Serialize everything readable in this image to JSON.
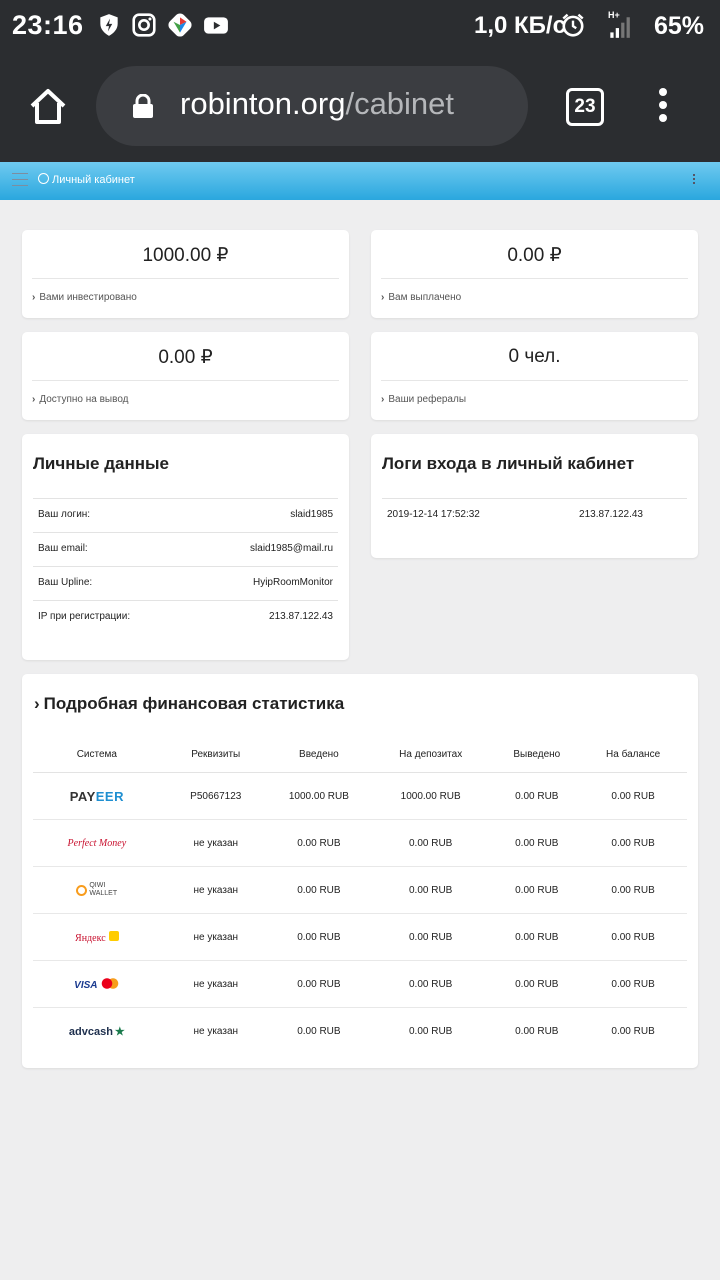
{
  "status_bar": {
    "time": "23:16",
    "net_speed": "1,0 КБ/с",
    "network": "H+",
    "battery": "65%",
    "left_icons": [
      "shield-bolt-icon",
      "instagram-icon",
      "cube-app-icon",
      "youtube-icon"
    ],
    "right_icons": [
      "alarm-icon",
      "signal-icon"
    ]
  },
  "browser": {
    "url_host": "robinton.org",
    "url_path": "/cabinet",
    "tab_count": "23"
  },
  "site_header": {
    "title": "Личный кабинет"
  },
  "stats": [
    {
      "value": "1000.00 ₽",
      "label": "Вами инвестировано"
    },
    {
      "value": "0.00 ₽",
      "label": "Вам выплачено"
    },
    {
      "value": "0.00 ₽",
      "label": "Доступно на вывод"
    },
    {
      "value": "0 чел.",
      "label": "Ваши рефералы"
    }
  ],
  "personal": {
    "title": "Личные данные",
    "rows": [
      {
        "label": "Ваш логин:",
        "value": "slaid1985"
      },
      {
        "label": "Ваш email:",
        "value": "slaid1985@mail.ru"
      },
      {
        "label": "Ваш Upline:",
        "value": "HyipRoomMonitor"
      },
      {
        "label": "IP при регистрации:",
        "value": "213.87.122.43"
      }
    ]
  },
  "logins": {
    "title": "Логи входа в личный кабинет",
    "rows": [
      {
        "date": "2019-12-14 17:52:32",
        "ip": "213.87.122.43"
      }
    ]
  },
  "finance": {
    "title": "Подробная финансовая статистика",
    "columns": [
      "Система",
      "Реквизиты",
      "Введено",
      "На депозитах",
      "Выведено",
      "На балансе"
    ],
    "rows": [
      {
        "system": "PAYEER",
        "details": "P50667123",
        "deposited": "1000.00 RUB",
        "on_deposits": "1000.00 RUB",
        "withdrawn": "0.00 RUB",
        "balance": "0.00 RUB"
      },
      {
        "system": "Perfect Money",
        "details": "не указан",
        "deposited": "0.00 RUB",
        "on_deposits": "0.00 RUB",
        "withdrawn": "0.00 RUB",
        "balance": "0.00 RUB"
      },
      {
        "system": "QIWI WALLET",
        "details": "не указан",
        "deposited": "0.00 RUB",
        "on_deposits": "0.00 RUB",
        "withdrawn": "0.00 RUB",
        "balance": "0.00 RUB"
      },
      {
        "system": "Яндекс",
        "details": "не указан",
        "deposited": "0.00 RUB",
        "on_deposits": "0.00 RUB",
        "withdrawn": "0.00 RUB",
        "balance": "0.00 RUB"
      },
      {
        "system": "VISA",
        "details": "не указан",
        "deposited": "0.00 RUB",
        "on_deposits": "0.00 RUB",
        "withdrawn": "0.00 RUB",
        "balance": "0.00 RUB"
      },
      {
        "system": "advcash",
        "details": "не указан",
        "deposited": "0.00 RUB",
        "on_deposits": "0.00 RUB",
        "withdrawn": "0.00 RUB",
        "balance": "0.00 RUB"
      }
    ]
  },
  "colors": {
    "accent": "#2aa7de",
    "dark_bar": "#2b2d30",
    "payeer_blue": "#1f8fd1",
    "pm_red": "#c8102e",
    "qiwi_orange": "#f89c1c",
    "advcash_green": "#1a7a4c"
  }
}
